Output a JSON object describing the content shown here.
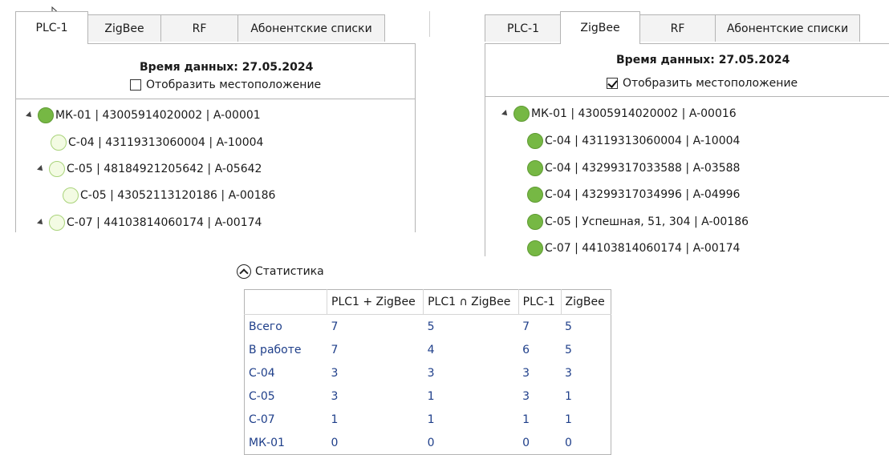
{
  "left_panel": {
    "tabs": [
      "PLC-1",
      "ZigBee",
      "RF",
      "Абонентские списки"
    ],
    "active_tab": "PLC-1",
    "data_time_label": "Время данных:",
    "data_time_value": "27.05.2024",
    "show_location_label": "Отобразить местоположение",
    "show_location_checked": false,
    "tree": [
      {
        "label": "МК-01 | 43005914020002 | A-00001",
        "status": "full",
        "expanded": true
      },
      {
        "label": "С-04 | 43119313060004 | A-10004",
        "status": "empty"
      },
      {
        "label": "С-05 | 48184921205642 | A-05642",
        "status": "empty",
        "expanded": true
      },
      {
        "label": "С-05 | 43052113120186 | A-00186",
        "status": "empty"
      },
      {
        "label": "С-07 | 44103814060174 | A-00174",
        "status": "empty",
        "expanded": true
      }
    ]
  },
  "right_panel": {
    "tabs": [
      "PLC-1",
      "ZigBee",
      "RF",
      "Абонентские списки"
    ],
    "active_tab": "ZigBee",
    "data_time_label": "Время данных:",
    "data_time_value": "27.05.2024",
    "show_location_label": "Отобразить местоположение",
    "show_location_checked": true,
    "tree": [
      {
        "label": "МК-01 | 43005914020002 | A-00016",
        "status": "full",
        "expanded": true
      },
      {
        "label": "С-04 | 43119313060004 | A-10004",
        "status": "full"
      },
      {
        "label": "С-04 | 43299317033588 | A-03588",
        "status": "full"
      },
      {
        "label": "С-04 | 43299317034996 | A-04996",
        "status": "full"
      },
      {
        "label": "С-05 | Успешная, 51, 304 | A-00186",
        "status": "full"
      },
      {
        "label": "С-07 | 44103814060174 | A-00174",
        "status": "full"
      }
    ]
  },
  "statistics": {
    "toggle_label": "Статистика",
    "columns": [
      "",
      "PLC1 + ZigBee",
      "PLC1 ∩ ZigBee",
      "PLC-1",
      "ZigBee"
    ],
    "rows": [
      [
        "Всего",
        "7",
        "5",
        "7",
        "5"
      ],
      [
        "В работе",
        "7",
        "4",
        "6",
        "5"
      ],
      [
        "С-04",
        "3",
        "3",
        "3",
        "3"
      ],
      [
        "С-05",
        "3",
        "1",
        "3",
        "1"
      ],
      [
        "С-07",
        "1",
        "1",
        "1",
        "1"
      ],
      [
        "МК-01",
        "0",
        "0",
        "0",
        "0"
      ]
    ]
  }
}
